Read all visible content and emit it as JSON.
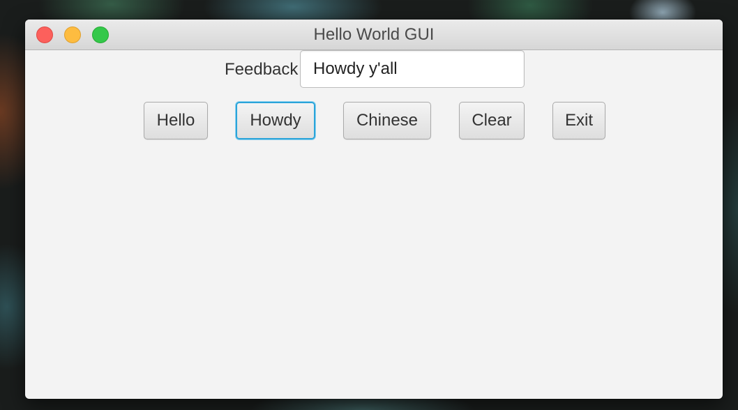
{
  "window": {
    "title": "Hello World GUI"
  },
  "feedback": {
    "label": "Feedback",
    "value": "Howdy y'all"
  },
  "buttons": {
    "hello": "Hello",
    "howdy": "Howdy",
    "chinese": "Chinese",
    "clear": "Clear",
    "exit": "Exit"
  },
  "colors": {
    "focus_ring": "#2aa4d9",
    "close": "#fc605c",
    "minimize": "#fdbc40",
    "zoom": "#34c84a"
  }
}
